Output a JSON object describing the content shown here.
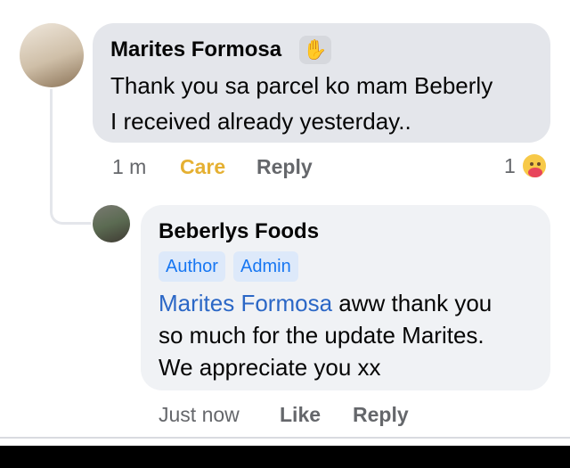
{
  "comment": {
    "author": "Marites Formosa",
    "author_icon": "wave-hand-icon",
    "lines": [
      "Thank you sa parcel ko mam Beberly",
      "I received already yesterday.."
    ],
    "time": "1 m",
    "reaction_label": "Care",
    "reply_label": "Reply",
    "reaction_count": "1",
    "reaction_icon": "care-emoji-icon"
  },
  "reply": {
    "author": "Beberlys Foods",
    "badges": [
      "Author",
      "Admin"
    ],
    "mention": "Marites Formosa",
    "line1_rest": " aww thank you",
    "line2": "so much for the update Marites.",
    "line3": "We appreciate you xx",
    "time": "Just now",
    "like_label": "Like",
    "reply_label": "Reply"
  },
  "colors": {
    "bubble_primary": "#e4e6eb",
    "bubble_secondary": "#f0f2f5",
    "mention_blue": "#2b67c6",
    "care_yellow": "#e5b032",
    "meta_gray": "#65676b"
  }
}
